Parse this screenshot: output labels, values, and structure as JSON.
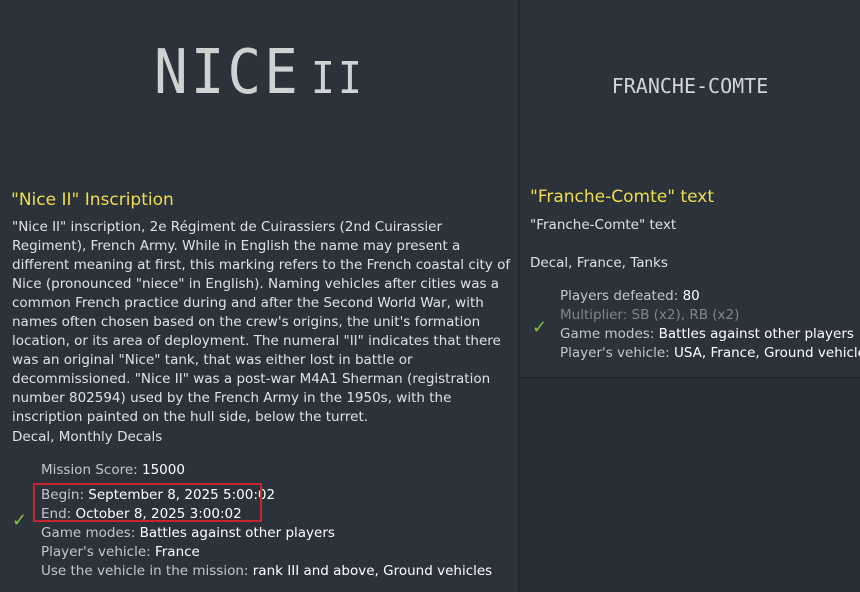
{
  "left": {
    "decal_text": "NICE",
    "decal_sub": "II",
    "title": "\"Nice II\" Inscription",
    "description": "\"Nice II\" inscription, 2e Régiment de Cuirassiers (2nd Cuirassier Regiment), French Army. While in English the name may present a different meaning at first, this marking refers to the French coastal city of Nice (pronounced \"niece\" in English). Naming vehicles after cities was a common French practice during and after the Second World War, with names often chosen based on the crew's origins, the unit's formation location, or its area of deployment. The numeral \"II\" indicates that there was an original \"Nice\" tank, that was either lost in battle or decommissioned. \"Nice II\" was a post-war M4A1 Sherman (registration number 802594) used by the French Army in the 1950s, with the inscription painted on the hull side, below the turret.",
    "tags": "Decal, Monthly Decals",
    "requirements": {
      "mission_score_label": "Mission Score: ",
      "mission_score_value": "15000",
      "begin_label": "Begin: ",
      "begin_value": "September 8, 2025 5:00:02",
      "end_label": "End: ",
      "end_value": "October 8, 2025 3:00:02",
      "game_modes_label": "Game modes: ",
      "game_modes_value": "Battles against other players",
      "vehicle_label": "Player's vehicle: ",
      "vehicle_value": "France",
      "use_label": "Use the vehicle in the mission: ",
      "use_value": "rank III and above, Ground vehicles"
    }
  },
  "right": {
    "decal_text": "FRANCHE-COMTE",
    "title": "\"Franche-Comte\" text",
    "subtitle": "\"Franche-Comte\" text",
    "tags": "Decal, France, Tanks",
    "requirements": {
      "defeated_label": "Players defeated: ",
      "defeated_value": "80",
      "multiplier_text": "Multiplier: SB (x2), RB (x2)",
      "game_modes_label": "Game modes: ",
      "game_modes_value": "Battles against other players",
      "vehicle_label": "Player's vehicle: ",
      "vehicle_value": "USA, France, Ground vehicles"
    }
  },
  "icons": {
    "check": "checkmark-icon"
  },
  "colors": {
    "title": "#f2dc4f",
    "check": "#88c43a",
    "highlight": "#c8262e"
  }
}
